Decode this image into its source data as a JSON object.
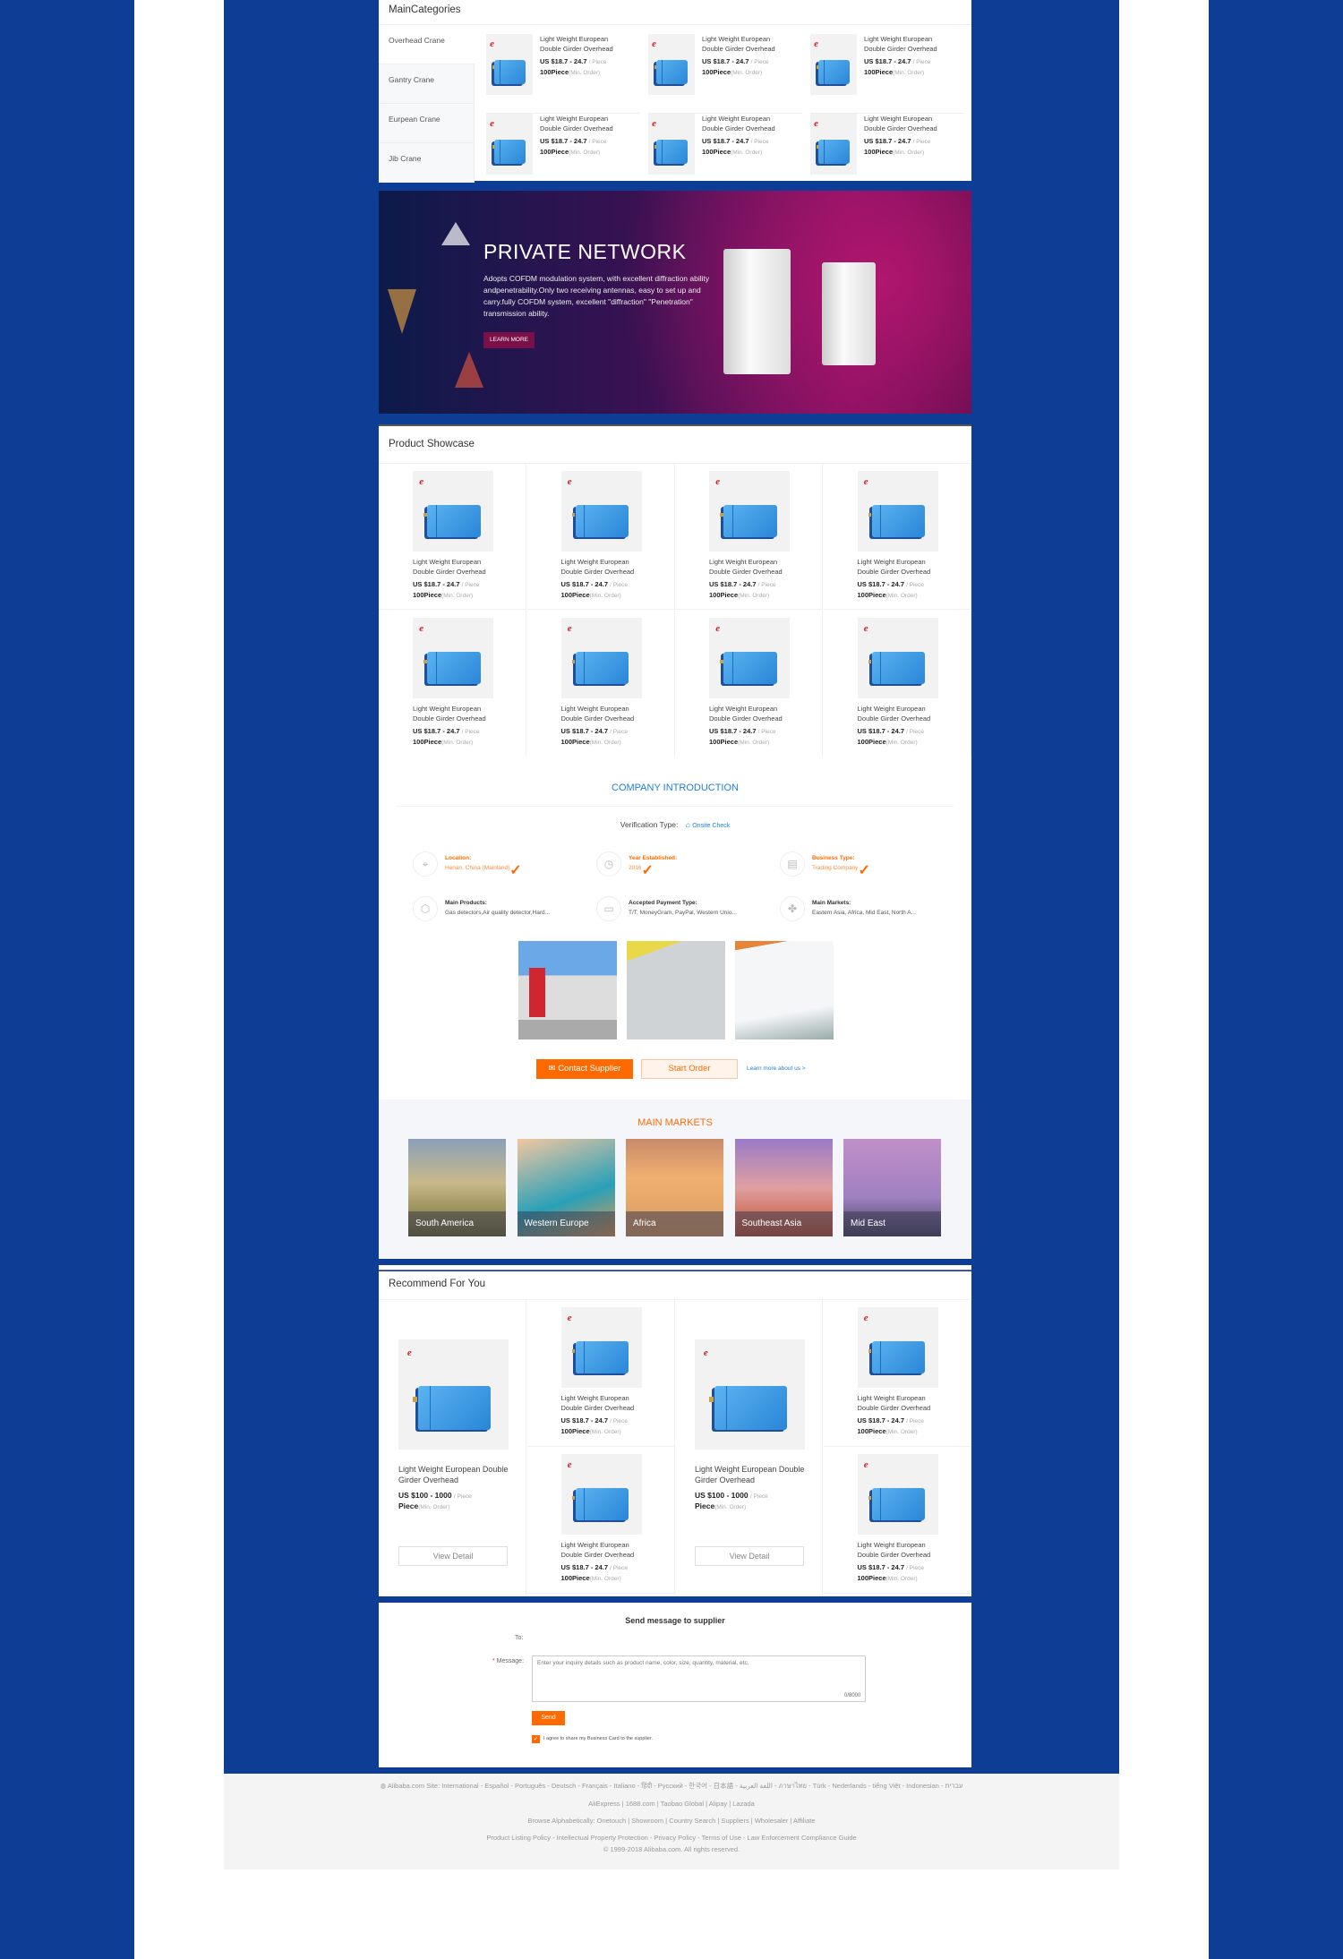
{
  "colors": {
    "frame_blue": "#0e3d96",
    "accent_orange": "#ff6a00",
    "link_blue": "#1e7fd8"
  },
  "main_categories": {
    "title": "MainCategories",
    "items": [
      {
        "label": "Overhead Crane"
      },
      {
        "label": "Gantry Crane"
      },
      {
        "label": "Eurpean Crane"
      },
      {
        "label": "Jib Crane"
      }
    ],
    "products": [
      {
        "title": "Light Weight European Double Girder Overhead",
        "price": "US $18.7 - 24.7",
        "unit": "/ Piece",
        "moq": "100Piece",
        "moq_note": "(Min. Order)"
      },
      {
        "title": "Light Weight European Double Girder Overhead",
        "price": "US $18.7 - 24.7",
        "unit": "/ Piece",
        "moq": "100Piece",
        "moq_note": "(Min. Order)"
      },
      {
        "title": "Light Weight European Double Girder Overhead",
        "price": "US $18.7 - 24.7",
        "unit": "/ Piece",
        "moq": "100Piece",
        "moq_note": "(Min. Order)"
      },
      {
        "title": "Light Weight European Double Girder Overhead",
        "price": "US $18.7 - 24.7",
        "unit": "/ Piece",
        "moq": "100Piece",
        "moq_note": "(Min. Order)"
      },
      {
        "title": "Light Weight European Double Girder Overhead",
        "price": "US $18.7 - 24.7",
        "unit": "/ Piece",
        "moq": "100Piece",
        "moq_note": "(Min. Order)"
      },
      {
        "title": "Light Weight European Double Girder Overhead",
        "price": "US $18.7 - 24.7",
        "unit": "/ Piece",
        "moq": "100Piece",
        "moq_note": "(Min. Order)"
      }
    ]
  },
  "banner": {
    "title": "PRIVATE NETWORK",
    "text": "Adopts COFDM modulation system, with excellent diffraction ability andpenetrability.Only two receiving antennas, easy to set up and carry.fully COFDM system, excellent \"diffraction\" \"Penetration\" transmission ability.",
    "button": "LEARN MORE"
  },
  "showcase": {
    "title": "Product Showcase",
    "products": [
      {
        "title": "Light Weight European Double Girder Overhead",
        "price": "US $18.7 - 24.7",
        "unit": "/ Piece",
        "moq": "100Piece",
        "moq_note": "(Min. Order)"
      },
      {
        "title": "Light Weight European Double Girder Overhead",
        "price": "US $18.7 - 24.7",
        "unit": "/ Piece",
        "moq": "100Piece",
        "moq_note": "(Min. Order)"
      },
      {
        "title": "Light Weight European Double Girder Overhead",
        "price": "US $18.7 - 24.7",
        "unit": "/ Piece",
        "moq": "100Piece",
        "moq_note": "(Min. Order)"
      },
      {
        "title": "Light Weight European Double Girder Overhead",
        "price": "US $18.7 - 24.7",
        "unit": "/ Piece",
        "moq": "100Piece",
        "moq_note": "(Min. Order)"
      },
      {
        "title": "Light Weight European Double Girder Overhead",
        "price": "US $18.7 - 24.7",
        "unit": "/ Piece",
        "moq": "100Piece",
        "moq_note": "(Min. Order)"
      },
      {
        "title": "Light Weight European Double Girder Overhead",
        "price": "US $18.7 - 24.7",
        "unit": "/ Piece",
        "moq": "100Piece",
        "moq_note": "(Min. Order)"
      },
      {
        "title": "Light Weight European Double Girder Overhead",
        "price": "US $18.7 - 24.7",
        "unit": "/ Piece",
        "moq": "100Piece",
        "moq_note": "(Min. Order)"
      },
      {
        "title": "Light Weight European Double Girder Overhead",
        "price": "US $18.7 - 24.7",
        "unit": "/ Piece",
        "moq": "100Piece",
        "moq_note": "(Min. Order)"
      }
    ]
  },
  "company": {
    "title": "COMPANY INTRODUCTION",
    "verification_label": "Verification Type:",
    "verification_value": "Onsite Check",
    "info": [
      {
        "icon": "location-pin-icon",
        "label": "Location:",
        "value": "Henan, China (Mainland)",
        "verified": true
      },
      {
        "icon": "clock-history-icon",
        "label": "Year Established:",
        "value": "2016",
        "verified": true
      },
      {
        "icon": "id-card-icon",
        "label": "Business Type:",
        "value": "Trading Company",
        "verified": true
      },
      {
        "icon": "box-icon",
        "label": "Main Products:",
        "value": "Gas detectors,Air quality detector,Hard...",
        "verified": false
      },
      {
        "icon": "credit-card-icon",
        "label": "Accepted Payment Type:",
        "value": "T/T, MoneyGram, PayPal, Western Unio...",
        "verified": false
      },
      {
        "icon": "puzzle-map-icon",
        "label": "Main Markets:",
        "value": "Eastern Asia, Africa, Mid East, North A...",
        "verified": false
      }
    ],
    "contact_button": "Contact Supplier",
    "order_button": "Start Order",
    "learn_more": "Learn more about us >"
  },
  "markets": {
    "title": "MAIN MARKETS",
    "items": [
      {
        "label": "South America"
      },
      {
        "label": "Western Europe"
      },
      {
        "label": "Africa"
      },
      {
        "label": "Southeast Asia"
      },
      {
        "label": "Mid East"
      }
    ]
  },
  "recommend": {
    "title": "Recommend For You",
    "large": [
      {
        "title": "Light Weight European Double Girder Overhead",
        "price": "US $100 - 1000",
        "unit": "/ Piece",
        "moq": "Piece",
        "moq_note": "(Min. Order)",
        "button": "View Detail"
      },
      {
        "title": "Light Weight European Double Girder Overhead",
        "price": "US $100 - 1000",
        "unit": "/ Piece",
        "moq": "Piece",
        "moq_note": "(Min. Order)",
        "button": "View Detail"
      }
    ],
    "small": [
      {
        "title": "Light Weight European Double Girder Overhead",
        "price": "US $18.7 - 24.7",
        "unit": "/ Piece",
        "moq": "100Piece",
        "moq_note": "(Min. Order)"
      },
      {
        "title": "Light Weight European Double Girder Overhead",
        "price": "US $18.7 - 24.7",
        "unit": "/ Piece",
        "moq": "100Piece",
        "moq_note": "(Min. Order)"
      },
      {
        "title": "Light Weight European Double Girder Overhead",
        "price": "US $18.7 - 24.7",
        "unit": "/ Piece",
        "moq": "100Piece",
        "moq_note": "(Min. Order)"
      },
      {
        "title": "Light Weight European Double Girder Overhead",
        "price": "US $18.7 - 24.7",
        "unit": "/ Piece",
        "moq": "100Piece",
        "moq_note": "(Min. Order)"
      }
    ]
  },
  "message": {
    "title": "Send message to supplier",
    "to_label": "To:",
    "message_label": "Message:",
    "placeholder": "Enter your inquiry details such as product name, color, size, quantity, material, etc.",
    "counter": "0/8000",
    "send": "Send",
    "agree": "I agree to share my Business Card to the supplier.",
    "agree_checked": true
  },
  "footer": {
    "sites": "Alibaba.com Site: International - Español - Português - Deutsch - Français - Italiano - हिंदी - Pусский - 한국어 - 日本語 - اللغة العربية - ภาษาไทย - Türk - Nederlands - tiếng Việt - Indonesian - עברית",
    "partners": "AliExpress | 1688.com | Taobao Global | Alipay | Lazada",
    "browse": "Browse Alphabetically: Onetouch | Showroom | Country Search | Suppliers | Wholesaler | Affiliate",
    "policies": "Product Listing Policy - Intellectual Property Protection - Privacy Policy - Terms of Use - Law Enforcement Compliance Guide",
    "copyright": "© 1999-2018 Alibaba.com. All rights reserved."
  }
}
